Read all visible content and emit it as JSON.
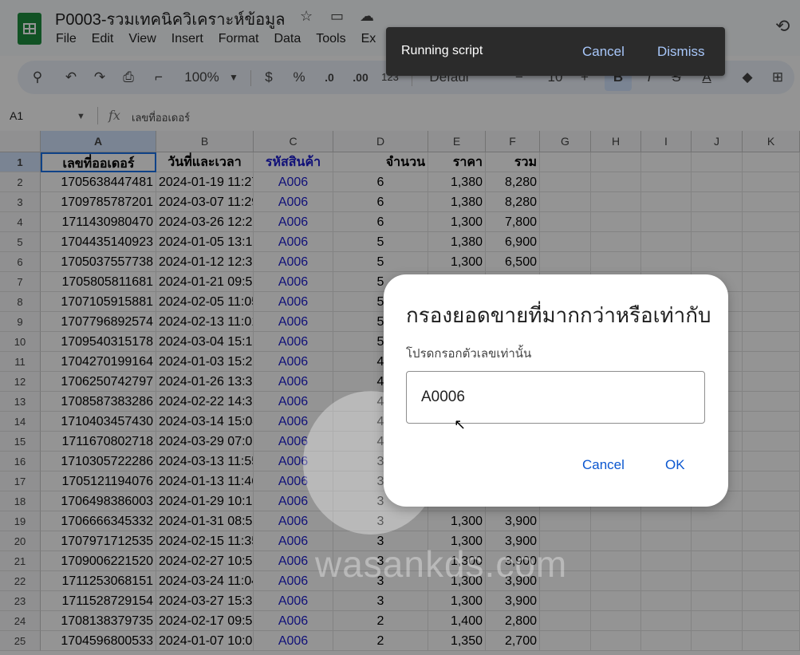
{
  "doc": {
    "title": "P0003-รวมเทคนิควิเคราะห์ข้อมูล"
  },
  "menu": [
    "File",
    "Edit",
    "View",
    "Insert",
    "Format",
    "Data",
    "Tools",
    "Ex"
  ],
  "toolbar": {
    "zoom": "100%",
    "currency": "$",
    "percent": "%",
    "dec_less": ".0",
    "dec_more": ".00",
    "number_format": "123",
    "font": "Defaul",
    "font_size": "10"
  },
  "formula_bar": {
    "cell_ref": "A1",
    "fx": "fx",
    "content": "เลขที่ออเดอร์"
  },
  "columns": [
    "A",
    "B",
    "C",
    "D",
    "E",
    "F",
    "G",
    "H",
    "I",
    "J",
    "K"
  ],
  "headers": [
    "เลขที่ออเดอร์",
    "วันที่และเวลา",
    "รหัสสินค้า",
    "จำนวน",
    "ราคา",
    "รวม"
  ],
  "rows": [
    [
      "1705638447481",
      "2024-01-19 11:27",
      "A006",
      "6",
      "1,380",
      "8,280"
    ],
    [
      "1709785787201",
      "2024-03-07 11:29",
      "A006",
      "6",
      "1,380",
      "8,280"
    ],
    [
      "1711430980470",
      "2024-03-26 12:29",
      "A006",
      "6",
      "1,300",
      "7,800"
    ],
    [
      "1704435140923",
      "2024-01-05 13:12",
      "A006",
      "5",
      "1,380",
      "6,900"
    ],
    [
      "1705037557738",
      "2024-01-12 12:32",
      "A006",
      "5",
      "1,300",
      "6,500"
    ],
    [
      "1705805811681",
      "2024-01-21 09:56",
      "A006",
      "5",
      "",
      ""
    ],
    [
      "1707105915881",
      "2024-02-05 11:05",
      "A006",
      "5",
      "",
      ""
    ],
    [
      "1707796892574",
      "2024-02-13 11:01",
      "A006",
      "5",
      "",
      ""
    ],
    [
      "1709540315178",
      "2024-03-04 15:18",
      "A006",
      "5",
      "",
      ""
    ],
    [
      "1704270199164",
      "2024-01-03 15:23",
      "A006",
      "4",
      "",
      ""
    ],
    [
      "1706250742797",
      "2024-01-26 13:32",
      "A006",
      "4",
      "",
      ""
    ],
    [
      "1708587383286",
      "2024-02-22 14:36",
      "A006",
      "4",
      "",
      ""
    ],
    [
      "1710403457430",
      "2024-03-14 15:04",
      "A006",
      "4",
      "",
      ""
    ],
    [
      "1711670802718",
      "2024-03-29 07:06",
      "A006",
      "4",
      "",
      ""
    ],
    [
      "1710305722286",
      "2024-03-13 11:55",
      "A006",
      "3",
      "",
      ""
    ],
    [
      "1705121194076",
      "2024-01-13 11:46",
      "A006",
      "3",
      "",
      ""
    ],
    [
      "1706498386003",
      "2024-01-29 10:19",
      "A006",
      "3",
      "",
      ""
    ],
    [
      "1706666345332",
      "2024-01-31 08:59",
      "A006",
      "3",
      "1,300",
      "3,900"
    ],
    [
      "1707971712535",
      "2024-02-15 11:35",
      "A006",
      "3",
      "1,300",
      "3,900"
    ],
    [
      "1709006221520",
      "2024-02-27 10:57",
      "A006",
      "3",
      "1,300",
      "3,900"
    ],
    [
      "1711253068151",
      "2024-03-24 11:04",
      "A006",
      "3",
      "1,300",
      "3,900"
    ],
    [
      "1711528729154",
      "2024-03-27 15:38",
      "A006",
      "3",
      "1,300",
      "3,900"
    ],
    [
      "1708138379735",
      "2024-02-17 09:53",
      "A006",
      "2",
      "1,400",
      "2,800"
    ],
    [
      "1704596800533",
      "2024-01-07 10:06",
      "A006",
      "2",
      "1,350",
      "2,700"
    ]
  ],
  "snackbar": {
    "text": "Running script",
    "cancel": "Cancel",
    "dismiss": "Dismiss"
  },
  "dialog": {
    "title": "กรองยอดขายที่มากกว่าหรือเท่ากับ",
    "message": "โปรดกรอกตัวเลขเท่านั้น",
    "input_value": "A0006",
    "cancel": "Cancel",
    "ok": "OK"
  },
  "watermark": {
    "text": "wasankds.com"
  }
}
